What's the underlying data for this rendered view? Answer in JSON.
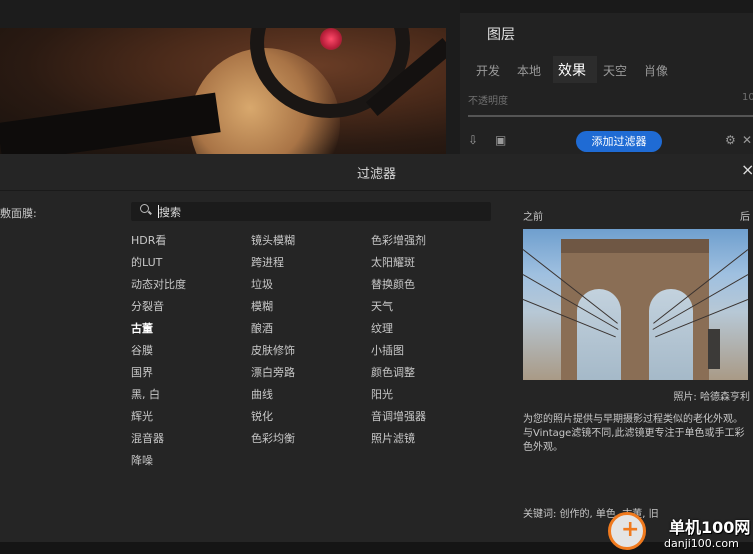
{
  "layers_panel": {
    "title": "图层",
    "tabs": [
      "开发",
      "本地",
      "效果",
      "天空",
      "肖像"
    ],
    "active_tab": "效果",
    "opacity_label": "不透明度",
    "opacity_max": "10",
    "add_filter_label": "添加过滤器"
  },
  "dialog": {
    "title": "过滤器",
    "close_label": "×",
    "mask_label": "敷面膜:",
    "search_value": "搜索",
    "columns": [
      [
        "HDR看",
        "的LUT",
        "动态对比度",
        "分裂音",
        "古董",
        "谷膜",
        "国界",
        "黑, 白",
        "辉光",
        "混音器",
        "降噪"
      ],
      [
        "镜头模糊",
        "跨进程",
        "垃圾",
        "模糊",
        "酿酒",
        "皮肤修饰",
        "漂白旁路",
        "曲线",
        "锐化",
        "色彩均衡"
      ],
      [
        "色彩增强剂",
        "太阳耀斑",
        "替换颜色",
        "天气",
        "纹理",
        "小插图",
        "颜色调整",
        "阳光",
        "音调增强器",
        "照片滤镜"
      ]
    ],
    "selected_filter": "古董",
    "preview": {
      "before_label": "之前",
      "after_label": "后",
      "credit": "照片: 哈德森亨利",
      "description": "为您的照片提供与早期摄影过程类似的老化外观。与Vintage滤镜不同,此滤镜更专注于单色或手工彩色外观。",
      "keywords": "关键词: 创作的, 单色, 古董, 旧"
    }
  },
  "watermark": {
    "line1": "单机100网",
    "line2": "danji100.com"
  }
}
